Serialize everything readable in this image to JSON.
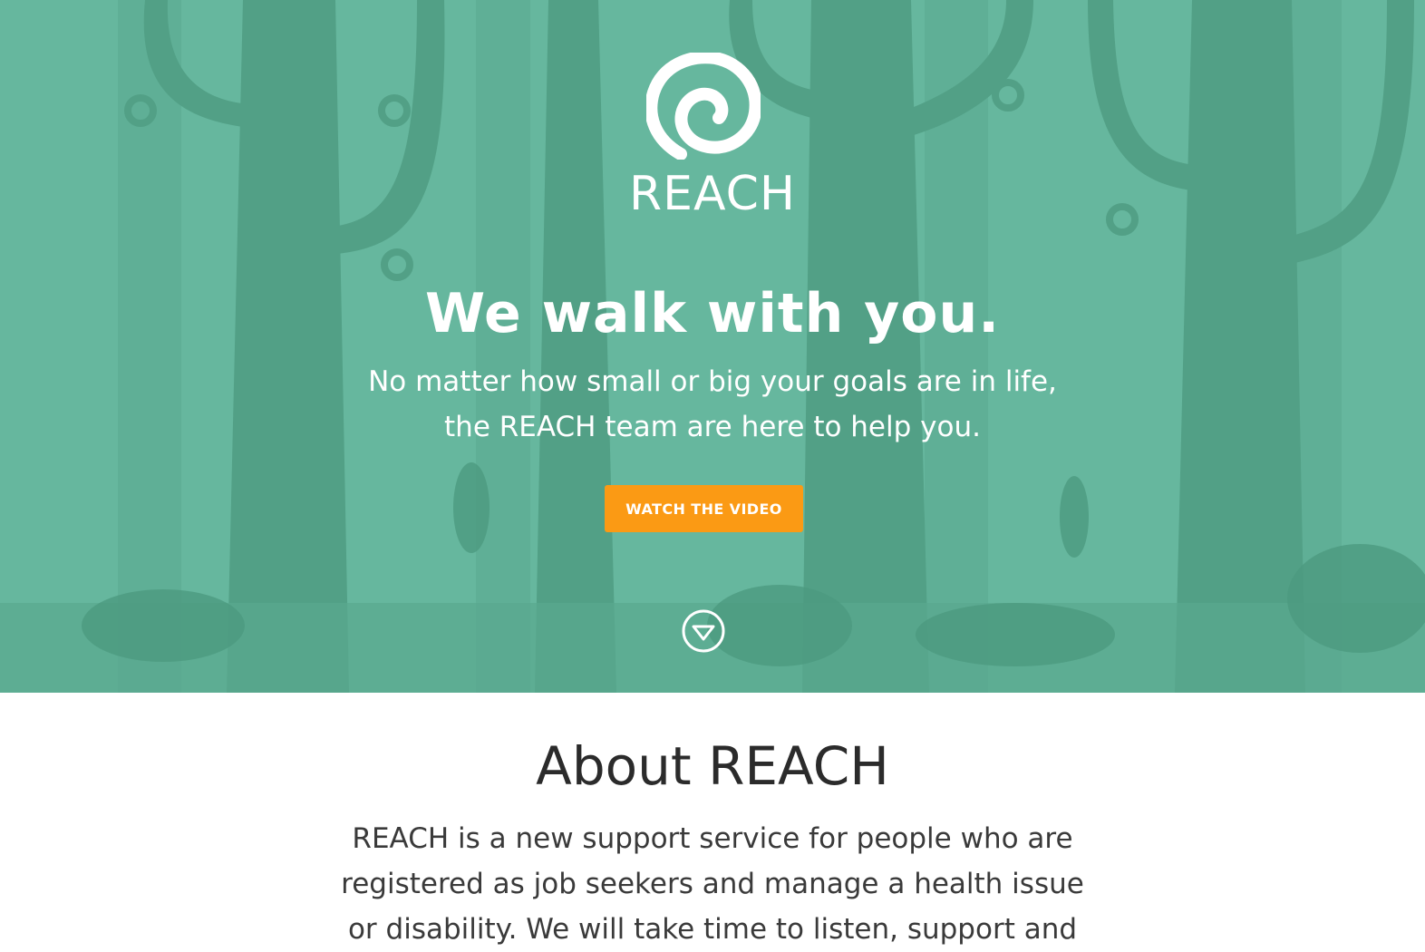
{
  "brand": {
    "name": "REACH",
    "logo_icon": "spiral-icon"
  },
  "hero": {
    "headline": "We walk with you.",
    "subline_1": "No matter how small or big your goals are in life,",
    "subline_2": "the REACH team are here to help you.",
    "cta_label": "WATCH THE VIDEO",
    "scroll_icon": "chevron-down-circle-icon",
    "colors": {
      "background": "#66b79e",
      "cta": "#fb9a14",
      "text": "#ffffff"
    }
  },
  "about": {
    "title": "About REACH",
    "body_1": "REACH is a new support service for people who are",
    "body_2": "registered as job seekers and manage a health issue",
    "body_3": "or disability. We will take time to listen, support and"
  }
}
